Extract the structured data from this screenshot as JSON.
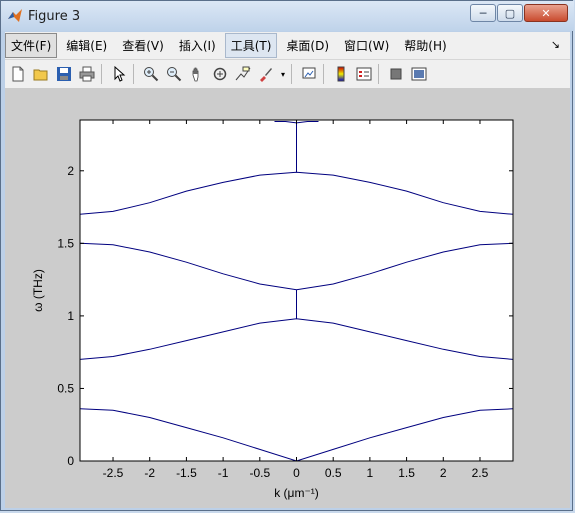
{
  "window": {
    "title": "Figure 3"
  },
  "menu": {
    "items": [
      "文件(F)",
      "编辑(E)",
      "查看(V)",
      "插入(I)",
      "工具(T)",
      "桌面(D)",
      "窗口(W)",
      "帮助(H)"
    ]
  },
  "toolbar": {
    "icons": [
      "new-figure-icon",
      "open-icon",
      "save-icon",
      "print-icon",
      "pointer-icon",
      "zoom-in-icon",
      "zoom-out-icon",
      "pan-icon",
      "rotate-icon",
      "data-cursor-icon",
      "brush-icon",
      "link-icon",
      "colorbar-icon",
      "legend-icon",
      "hide-plot-tools-icon",
      "show-plot-tools-icon"
    ]
  },
  "chart_data": {
    "type": "line",
    "xlabel": "k (μm⁻¹)",
    "ylabel": "ω (THz)",
    "xlim": [
      -2.95,
      2.95
    ],
    "ylim": [
      0,
      2.35
    ],
    "xticks": [
      -2.5,
      -2,
      -1.5,
      -1,
      -0.5,
      0,
      0.5,
      1,
      1.5,
      2,
      2.5
    ],
    "xtick_labels": [
      "-2.5",
      "-2",
      "-1.5",
      "-1",
      "-0.5",
      "0",
      "0.5",
      "1",
      "1.5",
      "2",
      "2.5"
    ],
    "yticks": [
      0,
      0.5,
      1,
      1.5,
      2
    ],
    "ytick_labels": [
      "0",
      "0.5",
      "1",
      "1.5",
      "2"
    ],
    "grid": false,
    "line_color": "#00007f",
    "series": [
      {
        "x": [
          -2.95,
          -2.5,
          -2,
          -1.5,
          -1,
          -0.5,
          0,
          0.5,
          1,
          1.5,
          2,
          2.5,
          2.95
        ],
        "y": [
          0.36,
          0.35,
          0.3,
          0.23,
          0.16,
          0.08,
          0,
          0.08,
          0.16,
          0.23,
          0.3,
          0.35,
          0.36
        ]
      },
      {
        "x": [
          -2.95,
          -2.5,
          -2,
          -1.5,
          -1,
          -0.5,
          0,
          0.5,
          1,
          1.5,
          2,
          2.5,
          2.95
        ],
        "y": [
          0.7,
          0.72,
          0.77,
          0.83,
          0.89,
          0.95,
          0.98,
          0.95,
          0.89,
          0.83,
          0.77,
          0.72,
          0.7
        ]
      },
      {
        "x": [
          -2.95,
          -2.5,
          -2,
          -1.5,
          -1,
          -0.5,
          0,
          0.5,
          1,
          1.5,
          2,
          2.5,
          2.95
        ],
        "y": [
          1.5,
          1.49,
          1.44,
          1.37,
          1.29,
          1.22,
          1.18,
          1.22,
          1.29,
          1.37,
          1.44,
          1.49,
          1.5
        ]
      },
      {
        "x": [
          -2.95,
          -2.5,
          -2,
          -1.5,
          -1,
          -0.5,
          0,
          0.5,
          1,
          1.5,
          2,
          2.5,
          2.95
        ],
        "y": [
          1.7,
          1.72,
          1.78,
          1.86,
          1.92,
          1.97,
          1.99,
          1.97,
          1.92,
          1.86,
          1.78,
          1.72,
          1.7
        ]
      },
      {
        "x": [
          -0.3,
          -0.15,
          0,
          0.15,
          0.3
        ],
        "y": [
          2.34,
          2.34,
          2.33,
          2.34,
          2.34
        ]
      },
      {
        "x": [
          0,
          0
        ],
        "y": [
          0.98,
          1.18
        ]
      },
      {
        "x": [
          0,
          0
        ],
        "y": [
          1.99,
          2.33
        ]
      }
    ]
  }
}
